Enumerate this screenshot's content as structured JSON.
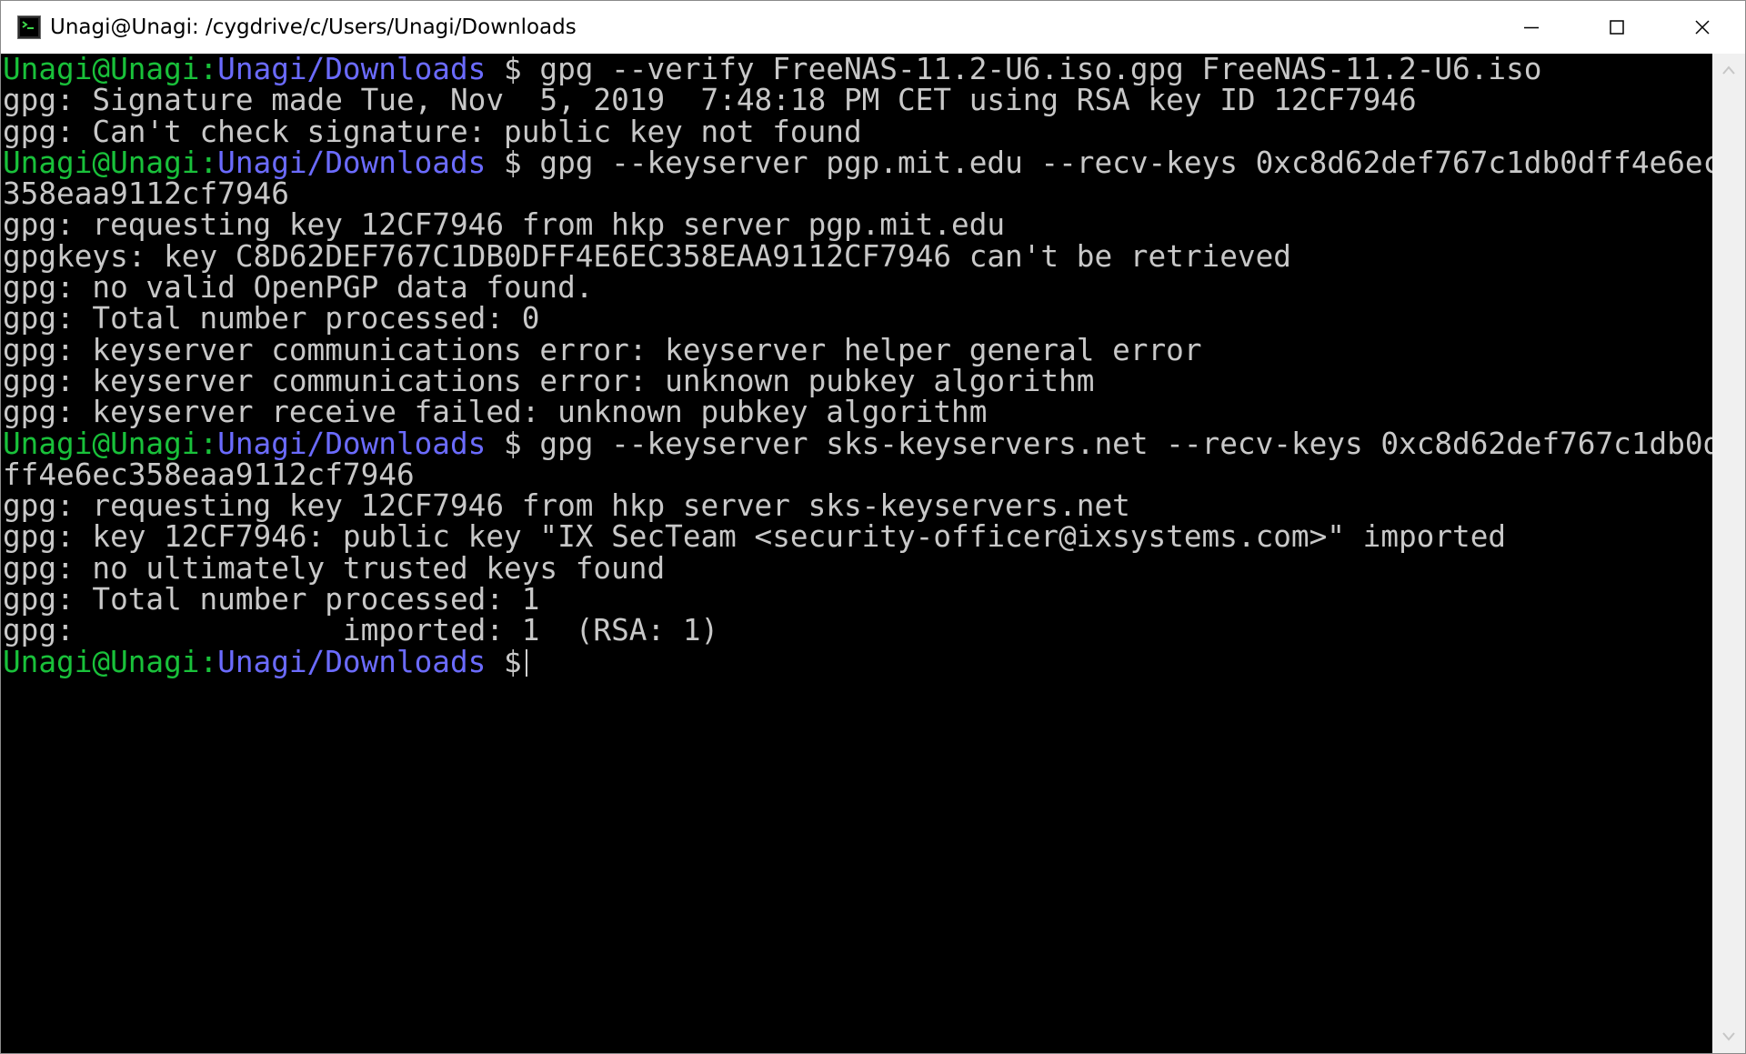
{
  "window": {
    "title": "Unagi@Unagi: /cygdrive/c/Users/Unagi/Downloads",
    "icons": {
      "app": "cygwin-terminal-icon",
      "minimize": "minimize-icon",
      "maximize": "maximize-icon",
      "close": "close-icon",
      "scroll_up": "scroll-up-arrow-icon",
      "scroll_down": "scroll-down-arrow-icon"
    }
  },
  "colors": {
    "background": "#000000",
    "text": "#c8c8c8",
    "prompt_user": "#19c13a",
    "prompt_path": "#6b6bff"
  },
  "terminal": {
    "lines": [
      {
        "type": "prompt",
        "user": "Unagi@Unagi:",
        "path": "Unagi/Downloads",
        "rest": " $ gpg --verify FreeNAS-11.2-U6.iso.gpg FreeNAS-11.2-U6.iso"
      },
      {
        "type": "output",
        "text": "gpg: Signature made Tue, Nov  5, 2019  7:48:18 PM CET using RSA key ID 12CF7946"
      },
      {
        "type": "output",
        "text": "gpg: Can't check signature: public key not found"
      },
      {
        "type": "prompt",
        "user": "Unagi@Unagi:",
        "path": "Unagi/Downloads",
        "rest": " $ gpg --keyserver pgp.mit.edu --recv-keys 0xc8d62def767c1db0dff4e6ec"
      },
      {
        "type": "output",
        "text": "358eaa9112cf7946"
      },
      {
        "type": "output",
        "text": "gpg: requesting key 12CF7946 from hkp server pgp.mit.edu"
      },
      {
        "type": "output",
        "text": "gpgkeys: key C8D62DEF767C1DB0DFF4E6EC358EAA9112CF7946 can't be retrieved"
      },
      {
        "type": "output",
        "text": "gpg: no valid OpenPGP data found."
      },
      {
        "type": "output",
        "text": "gpg: Total number processed: 0"
      },
      {
        "type": "output",
        "text": "gpg: keyserver communications error: keyserver helper general error"
      },
      {
        "type": "output",
        "text": "gpg: keyserver communications error: unknown pubkey algorithm"
      },
      {
        "type": "output",
        "text": "gpg: keyserver receive failed: unknown pubkey algorithm"
      },
      {
        "type": "prompt",
        "user": "Unagi@Unagi:",
        "path": "Unagi/Downloads",
        "rest": " $ gpg --keyserver sks-keyservers.net --recv-keys 0xc8d62def767c1db0d"
      },
      {
        "type": "output",
        "text": "ff4e6ec358eaa9112cf7946"
      },
      {
        "type": "output",
        "text": "gpg: requesting key 12CF7946 from hkp server sks-keyservers.net"
      },
      {
        "type": "output",
        "text": "gpg: key 12CF7946: public key \"IX SecTeam <security-officer@ixsystems.com>\" imported"
      },
      {
        "type": "output",
        "text": "gpg: no ultimately trusted keys found"
      },
      {
        "type": "output",
        "text": "gpg: Total number processed: 1"
      },
      {
        "type": "output",
        "text": "gpg:               imported: 1  (RSA: 1)"
      },
      {
        "type": "prompt",
        "user": "Unagi@Unagi:",
        "path": "Unagi/Downloads",
        "rest": " $",
        "cursor": true
      }
    ]
  }
}
